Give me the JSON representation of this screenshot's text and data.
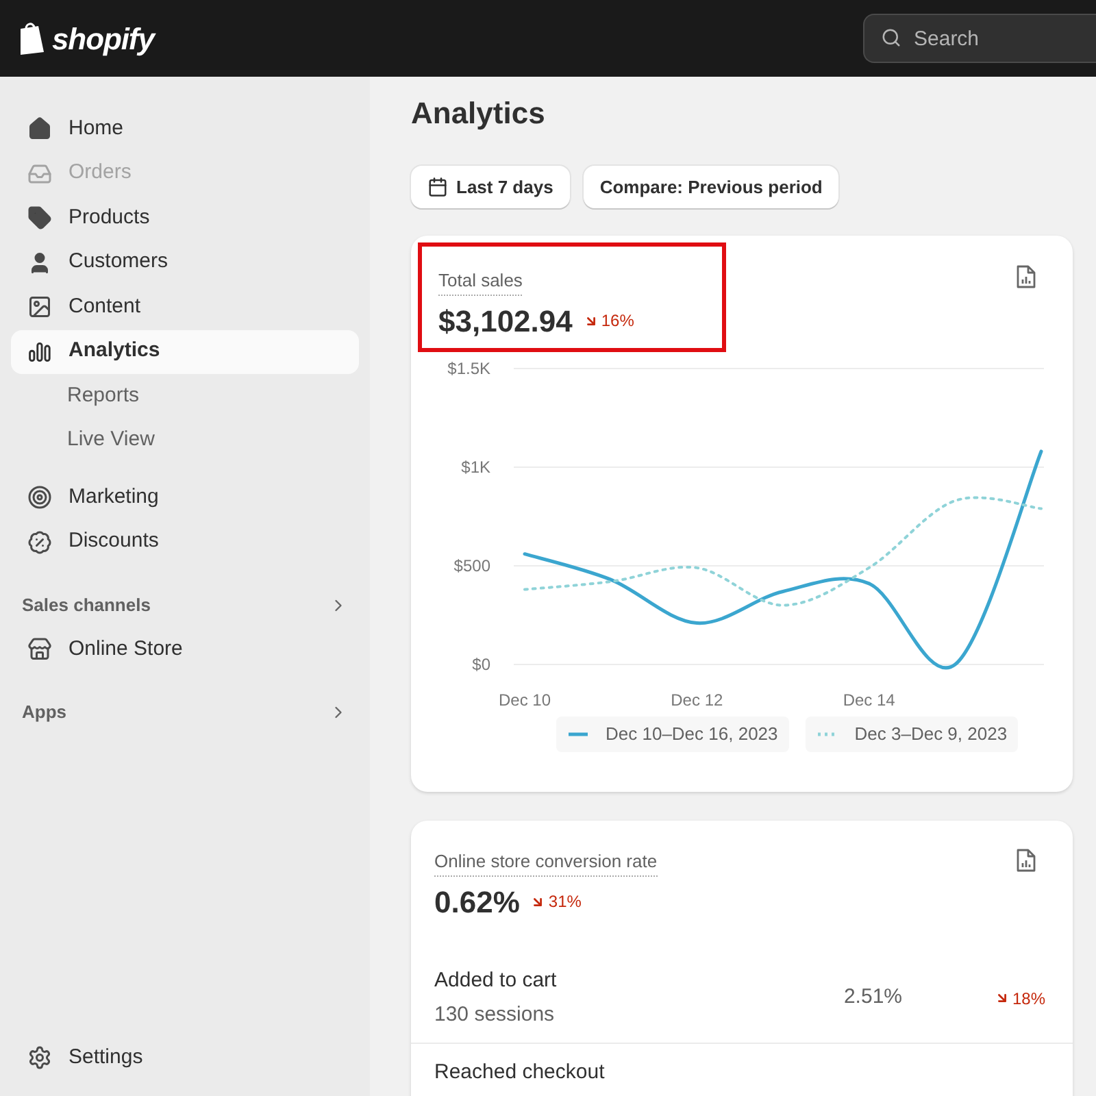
{
  "header": {
    "logo": "shopify",
    "search": {
      "placeholder": "Search"
    }
  },
  "sidebar": {
    "items": [
      {
        "label": "Home",
        "selected": false,
        "disabled": false
      },
      {
        "label": "Orders",
        "selected": false,
        "disabled": true
      },
      {
        "label": "Products",
        "selected": false,
        "disabled": false
      },
      {
        "label": "Customers",
        "selected": false,
        "disabled": false
      },
      {
        "label": "Content",
        "selected": false,
        "disabled": false
      },
      {
        "label": "Analytics",
        "selected": true,
        "disabled": false,
        "children": [
          {
            "label": "Reports"
          },
          {
            "label": "Live View"
          }
        ]
      },
      {
        "label": "Marketing",
        "selected": false,
        "disabled": false
      },
      {
        "label": "Discounts",
        "selected": false,
        "disabled": false
      }
    ],
    "sections": [
      {
        "title": "Sales channels",
        "items": [
          {
            "label": "Online Store"
          }
        ]
      },
      {
        "title": "Apps"
      }
    ],
    "footer": {
      "label": "Settings"
    }
  },
  "page": {
    "title": "Analytics",
    "filters": [
      {
        "label": "Last 7 days"
      },
      {
        "label": "Compare: Previous period"
      }
    ]
  },
  "total_sales": {
    "label": "Total sales",
    "value": "$3,102.94",
    "change": "16%",
    "highlighted": true,
    "chart_data": {
      "type": "line",
      "categories": [
        "Dec 10",
        null,
        "Dec 12",
        null,
        "Dec 14",
        null,
        null
      ],
      "series": [
        {
          "name": "Dec 10–Dec 16, 2023",
          "color": "#3ba6cf",
          "line_style": "solid",
          "values": [
            560,
            430,
            210,
            370,
            410,
            0,
            1080
          ]
        },
        {
          "name": "Dec 3–Dec 9, 2023",
          "color": "#8fd3d8",
          "line_style": "dashed",
          "values": [
            380,
            420,
            490,
            300,
            490,
            830,
            790
          ]
        }
      ],
      "yticks": [
        {
          "value": 0,
          "label": "$0"
        },
        {
          "value": 500,
          "label": "$500"
        },
        {
          "value": 1000,
          "label": "$1K"
        },
        {
          "value": 1500,
          "label": "$1.5K"
        }
      ],
      "ylim": [
        0,
        1500
      ],
      "legend": "bottom"
    }
  },
  "conversion": {
    "label": "Online store conversion rate",
    "value": "0.62%",
    "change": "31%",
    "rows": [
      {
        "label": "Added to cart",
        "sessions": "130 sessions",
        "rate": "2.51%",
        "change": "18%"
      },
      {
        "label": "Reached checkout"
      }
    ]
  }
}
